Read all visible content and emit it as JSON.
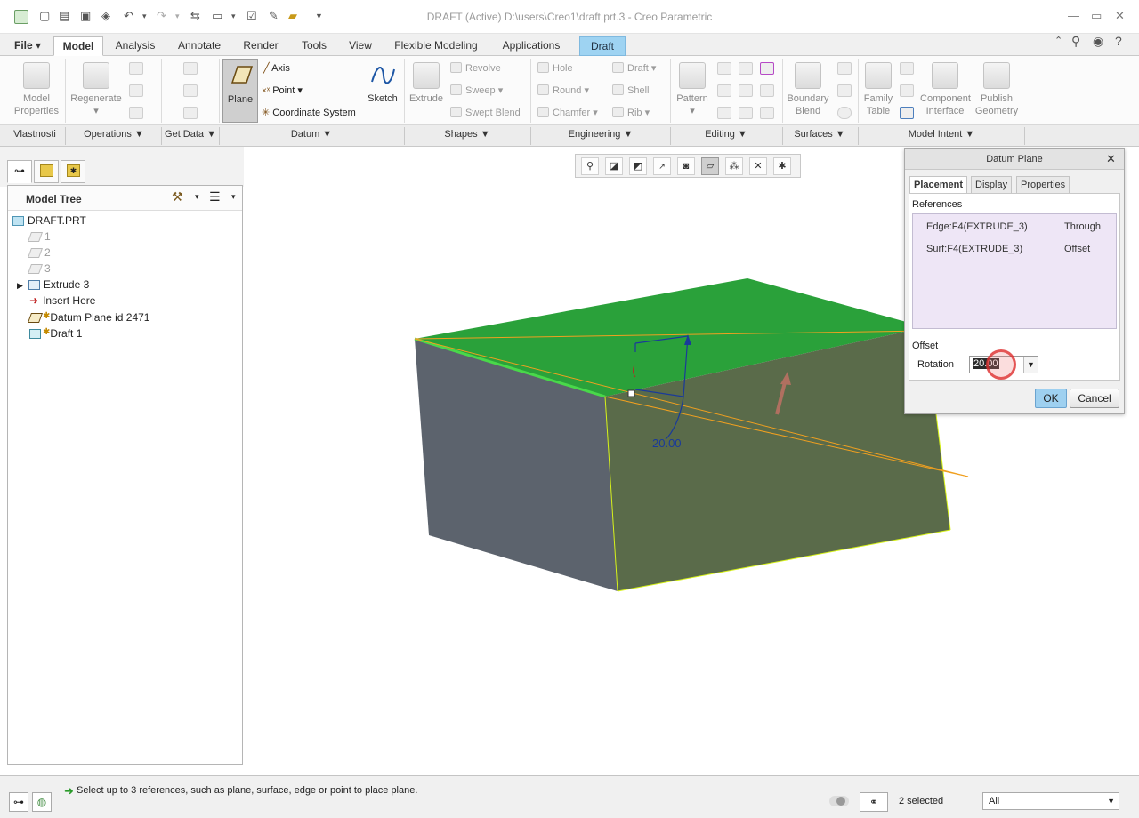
{
  "window": {
    "title": "DRAFT (Active) D:\\users\\Creo1\\draft.prt.3 - Creo Parametric"
  },
  "tabs": [
    {
      "label": "File"
    },
    {
      "label": "Model"
    },
    {
      "label": "Analysis"
    },
    {
      "label": "Annotate"
    },
    {
      "label": "Render"
    },
    {
      "label": "Tools"
    },
    {
      "label": "View"
    },
    {
      "label": "Flexible Modeling"
    },
    {
      "label": "Applications"
    },
    {
      "label": "Draft"
    }
  ],
  "ribbon": {
    "model_properties": "Model\nProperties",
    "regenerate": "Regenerate",
    "plane": "Plane",
    "axis": "Axis",
    "point": "Point",
    "coordinate_system": "Coordinate System",
    "sketch": "Sketch",
    "extrude": "Extrude",
    "revolve": "Revolve",
    "sweep": "Sweep",
    "swept_blend": "Swept Blend",
    "hole": "Hole",
    "round": "Round",
    "chamfer": "Chamfer",
    "draft": "Draft",
    "shell": "Shell",
    "rib": "Rib",
    "pattern": "Pattern",
    "boundary_blend": "Boundary\nBlend",
    "family_table": "Family\nTable",
    "component_interface": "Component\nInterface",
    "publish_geometry": "Publish\nGeometry"
  },
  "groups": [
    {
      "label": "Vlastnosti"
    },
    {
      "label": "Operations ▼"
    },
    {
      "label": "Get Data ▼"
    },
    {
      "label": "Datum ▼"
    },
    {
      "label": "Shapes ▼"
    },
    {
      "label": "Engineering ▼"
    },
    {
      "label": "Editing ▼"
    },
    {
      "label": "Surfaces ▼"
    },
    {
      "label": "Model Intent ▼"
    }
  ],
  "model_tree": {
    "header": "Model Tree",
    "items": [
      {
        "label": "DRAFT.PRT"
      },
      {
        "label": "1"
      },
      {
        "label": "2"
      },
      {
        "label": "3"
      },
      {
        "label": "Extrude 3"
      },
      {
        "label": "Insert Here"
      },
      {
        "label": "Datum Plane id 2471"
      },
      {
        "label": "Draft 1"
      }
    ]
  },
  "viewport": {
    "dimension_label": "20.00"
  },
  "dialog": {
    "title": "Datum Plane",
    "tabs": [
      {
        "label": "Placement"
      },
      {
        "label": "Display"
      },
      {
        "label": "Properties"
      }
    ],
    "references_label": "References",
    "references": [
      {
        "name": "Edge:F4(EXTRUDE_3)",
        "type": "Through"
      },
      {
        "name": "Surf:F4(EXTRUDE_3)",
        "type": "Offset"
      }
    ],
    "offset_label": "Offset",
    "rotation_label": "Rotation",
    "rotation_value": "20.00",
    "ok": "OK",
    "cancel": "Cancel"
  },
  "status": {
    "message": "Select up to 3 references, such as plane, surface, edge or point to place plane.",
    "selected": "2 selected",
    "filter": "All"
  },
  "colors": {
    "top_face": "#2aa13a",
    "front_face": "#5a6b4a",
    "side_face": "#5c636d",
    "draft_tab": "#9ed3f2"
  }
}
